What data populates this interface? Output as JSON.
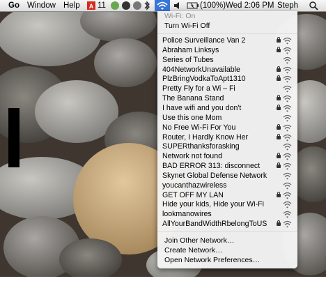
{
  "menubar": {
    "apple": "",
    "items": [
      "Go",
      "Window",
      "Help"
    ],
    "adobe_count": "11",
    "battery_text": "(100%)",
    "clock": "Wed 2:06 PM",
    "user": "Steph"
  },
  "wifi_menu": {
    "status": "Wi-Fi: On",
    "toggle": "Turn Wi-Fi Off",
    "networks": [
      {
        "name": "Police Surveillance Van 2",
        "locked": true
      },
      {
        "name": "Abraham Linksys",
        "locked": true
      },
      {
        "name": "Series of Tubes",
        "locked": false
      },
      {
        "name": "404NetworkUnavailable",
        "locked": true
      },
      {
        "name": "PlzBringVodkaToApt1310",
        "locked": true
      },
      {
        "name": "Pretty Fly for a Wi – Fi",
        "locked": false
      },
      {
        "name": "The Banana Stand",
        "locked": true
      },
      {
        "name": "I have wifi and you don't",
        "locked": true
      },
      {
        "name": "Use this one Mom",
        "locked": false
      },
      {
        "name": "No Free Wi-Fi For You",
        "locked": true
      },
      {
        "name": "Router, I Hardly Know Her",
        "locked": true
      },
      {
        "name": "SUPERthanksforasking",
        "locked": false
      },
      {
        "name": "Network not found",
        "locked": true
      },
      {
        "name": "BAD ERROR 313: disconnect",
        "locked": true
      },
      {
        "name": "Skynet Global Defense Network",
        "locked": false
      },
      {
        "name": "youcanthazwireless",
        "locked": false
      },
      {
        "name": "GET OFF MY LAN",
        "locked": true
      },
      {
        "name": "Hide your kids, Hide your Wi-Fi",
        "locked": false
      },
      {
        "name": "lookmanowires",
        "locked": false
      },
      {
        "name": "AllYourBandWidthRbelongToUS",
        "locked": true
      }
    ],
    "footer": [
      "Join Other Network…",
      "Create Network…",
      "Open Network Preferences…"
    ]
  },
  "colors": {
    "accent": "#3875d7"
  }
}
